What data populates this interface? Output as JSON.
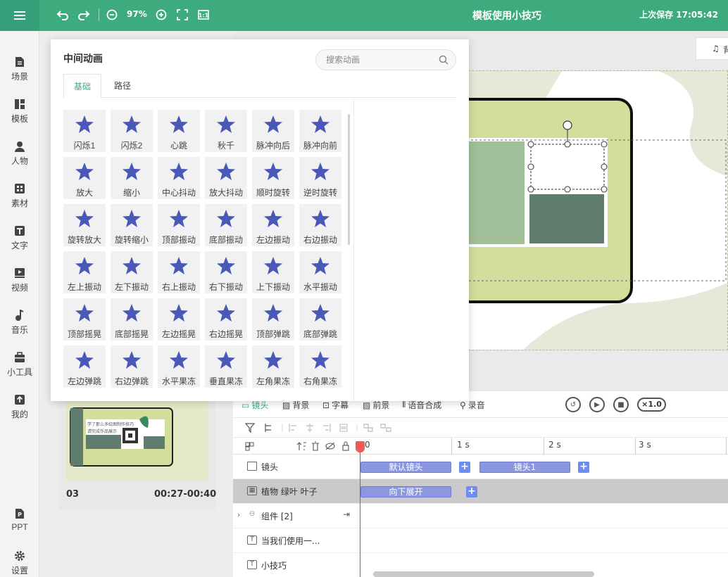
{
  "topbar": {
    "zoom": "97%",
    "title": "模板使用小技巧",
    "save_status": "上次保存 17:05:42"
  },
  "sidebar": {
    "items": [
      {
        "label": "场景",
        "icon": "scene-icon"
      },
      {
        "label": "模板",
        "icon": "template-icon"
      },
      {
        "label": "人物",
        "icon": "person-icon"
      },
      {
        "label": "素材",
        "icon": "material-icon"
      },
      {
        "label": "文字",
        "icon": "text-icon"
      },
      {
        "label": "视频",
        "icon": "video-icon"
      },
      {
        "label": "音乐",
        "icon": "music-icon"
      },
      {
        "label": "小工具",
        "icon": "toolbox-icon"
      },
      {
        "label": "我的",
        "icon": "upload-icon"
      }
    ],
    "bottom": [
      {
        "label": "PPT",
        "icon": "ppt-icon"
      },
      {
        "label": "设置",
        "icon": "gear-icon"
      }
    ]
  },
  "scene": {
    "number": "03",
    "time_range": "00:27-00:40",
    "thumb_text_1": "学了那么多绘图制作技巧",
    "thumb_text_2": "请完成作品展示"
  },
  "canvas": {
    "bg_music_label": "背"
  },
  "timeline": {
    "tabs": [
      {
        "label": "镜头",
        "active": true
      },
      {
        "label": "背景"
      },
      {
        "label": "字幕"
      },
      {
        "label": "前景"
      },
      {
        "label": "语音合成"
      },
      {
        "label": "录音"
      }
    ],
    "speed": "×1.0",
    "ruler": [
      "0",
      "1 s",
      "2 s",
      "3 s"
    ],
    "rows": [
      {
        "label": "镜头",
        "icon": "camera-icon",
        "clips": [
          "默认镜头",
          "镜头1"
        ]
      },
      {
        "label": "植物 绿叶 叶子",
        "icon": "image-icon",
        "clips": [
          "向下展开"
        ]
      },
      {
        "label": "组件 [2]",
        "icon": "group-icon"
      },
      {
        "label": "当我们使用一...",
        "icon": "text-icon"
      },
      {
        "label": "小技巧",
        "icon": "text-icon"
      }
    ]
  },
  "anim_popup": {
    "title": "中间动画",
    "search_placeholder": "搜索动画",
    "tabs": [
      "基础",
      "路径"
    ],
    "items": [
      "闪烁1",
      "闪烁2",
      "心跳",
      "秋千",
      "脉冲向后",
      "脉冲向前",
      "放大",
      "缩小",
      "中心抖动",
      "放大抖动",
      "顺时旋转",
      "逆时旋转",
      "旋转放大",
      "旋转缩小",
      "顶部振动",
      "底部振动",
      "左边振动",
      "右边振动",
      "左上振动",
      "左下振动",
      "右上振动",
      "右下振动",
      "上下振动",
      "水平振动",
      "顶部摇晃",
      "底部摇晃",
      "左边摇晃",
      "右边摇晃",
      "顶部弹跳",
      "底部弹跳",
      "左边弹跳",
      "右边弹跳",
      "水平果冻",
      "垂直果冻",
      "左角果冻",
      "右角果冻"
    ]
  },
  "colors": {
    "brand": "#3eab7f",
    "star": "#4a58b8",
    "clip": "#8b98e0",
    "playhead": "#e0394a"
  }
}
